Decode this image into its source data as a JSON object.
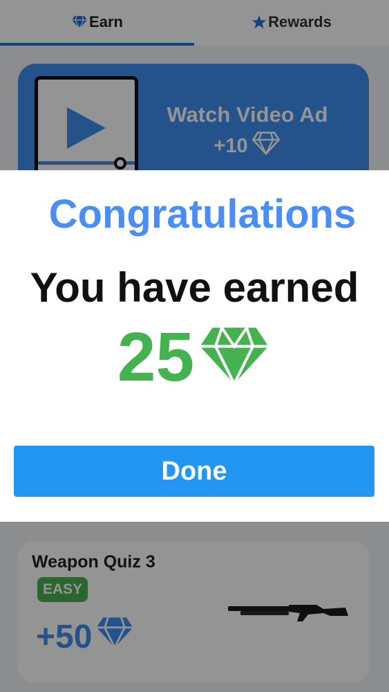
{
  "tabs": {
    "earn": {
      "label": "Earn",
      "icon": "diamond-icon",
      "active": true
    },
    "rewards": {
      "label": "Rewards",
      "icon": "star-icon",
      "active": false
    }
  },
  "watch_ad": {
    "title": "Watch Video Ad",
    "reward": "+10",
    "icon": "diamond-icon"
  },
  "quiz": {
    "title": "Weapon Quiz 3",
    "difficulty": "EASY",
    "reward": "+50",
    "image": "shotgun-image"
  },
  "dialog": {
    "title": "Congratulations",
    "message": "You have earned",
    "amount": "25",
    "button": "Done"
  },
  "colors": {
    "accent_blue": "#2196f3",
    "dialog_title": "#4a8ef2",
    "reward_green": "#43b24f",
    "tab_indicator": "#1976d2"
  }
}
